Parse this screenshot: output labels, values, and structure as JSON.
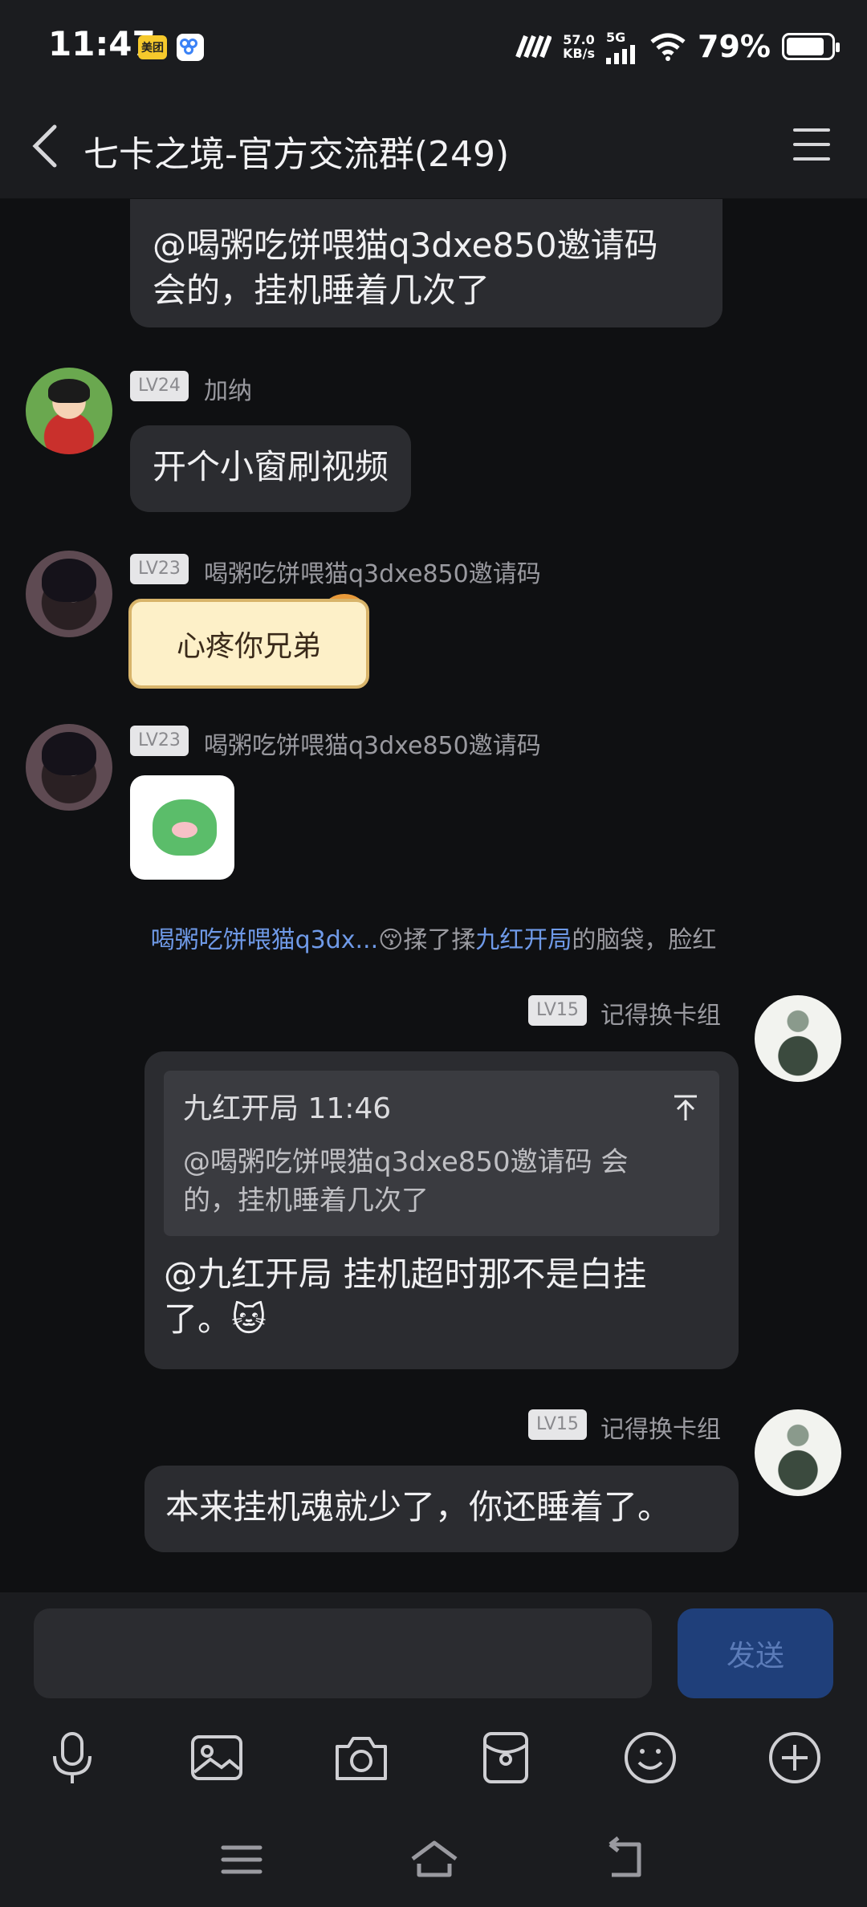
{
  "status_bar": {
    "time": "11:47",
    "app_badge": "美团",
    "speed_value": "57.0",
    "speed_unit": "KB/s",
    "network": "5G",
    "battery": "79%"
  },
  "header": {
    "title": "七卡之境-官方交流群(249)"
  },
  "messages": {
    "m0": {
      "text_line1": "@喝粥吃饼喂猫q3dxe850邀请码",
      "text_line2": "会的，挂机睡着几次了"
    },
    "m1": {
      "level": "LV24",
      "name": "加纳",
      "text": "开个小窗刷视频"
    },
    "m2": {
      "level": "LV23",
      "name": "喝粥吃饼喂猫q3dxe850邀请码",
      "sticker_text": "心疼你兄弟"
    },
    "m3": {
      "level": "LV23",
      "name": "喝粥吃饼喂猫q3dxe850邀请码"
    },
    "system": {
      "actor": "喝粥吃饼喂猫q3dx...",
      "emoji": "😚",
      "action": "揉了揉",
      "target": "九红开局",
      "suffix": "的脑袋，脸红"
    },
    "m4": {
      "level": "LV15",
      "name": "记得换卡组",
      "quote_head": "九红开局 11:46",
      "quote_line1": "@喝粥吃饼喂猫q3dxe850邀请码 会",
      "quote_line2": "的，挂机睡着几次了",
      "text_line1": "@九红开局 挂机超时那不是白挂",
      "text_line2": "了。",
      "emoji": "🐱"
    },
    "m5": {
      "level": "LV15",
      "name": "记得换卡组",
      "text": "本来挂机魂就少了，你还睡着了。"
    }
  },
  "composer": {
    "placeholder": "",
    "send_label": "发送"
  }
}
